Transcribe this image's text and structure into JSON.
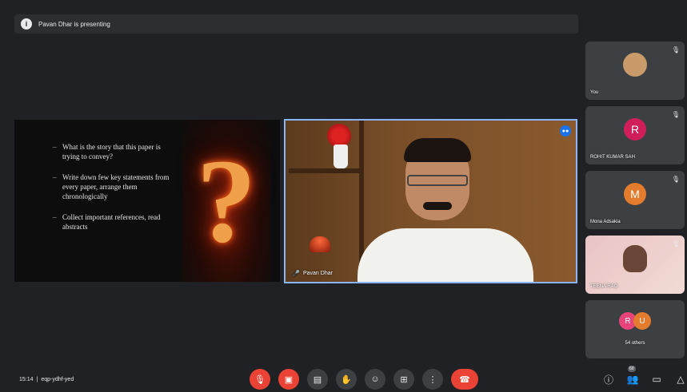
{
  "top_bar": {
    "text": "Pavan Dhar is presenting"
  },
  "slide": {
    "bullets": [
      "What is the story that this paper is trying to convey?",
      "Write down few key statements from every paper, arrange them chronologically",
      "Collect important references, read abstracts"
    ],
    "art_glyph": "?"
  },
  "main_video": {
    "name": "Pavan Dhar"
  },
  "participants": [
    {
      "name": "You",
      "initial": ""
    },
    {
      "name": "ROHIT KUMAR SAH",
      "initial": "R",
      "color": "#d01e5a"
    },
    {
      "name": "Mona Adsakia",
      "initial": "M",
      "color": "#e37c2c"
    },
    {
      "name": "TEENA RAO",
      "initial": ""
    }
  ],
  "others": {
    "label": "54 others",
    "initials": [
      "R",
      "U"
    ],
    "colors": [
      "#e8447a",
      "#e37c2c"
    ]
  },
  "bottom": {
    "time": "15:14",
    "separator": "|",
    "code": "eqp-ydhf-yed",
    "people_count": "60"
  },
  "colors": {
    "background": "#202124",
    "accent": "#8ab4f8",
    "danger": "#ea4335"
  }
}
